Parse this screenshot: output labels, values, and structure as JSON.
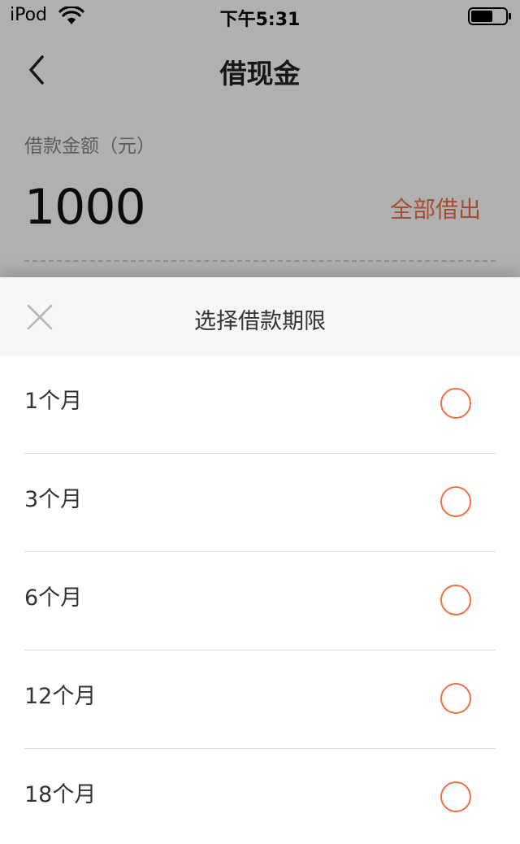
{
  "status_bar": {
    "carrier": "iPod",
    "time": "下午5:31",
    "icons": [
      "wifi-icon",
      "battery-icon"
    ]
  },
  "nav": {
    "title": "借现金",
    "back_icon": "chevron-left-icon"
  },
  "loan": {
    "amount_label": "借款金额（元）",
    "amount_value": "1000",
    "borrow_all_label": "全部借出"
  },
  "sheet": {
    "title": "选择借款期限",
    "close_icon": "close-icon",
    "terms": [
      {
        "label": "1个月",
        "selected": false
      },
      {
        "label": "3个月",
        "selected": false
      },
      {
        "label": "6个月",
        "selected": false
      },
      {
        "label": "12个月",
        "selected": false
      },
      {
        "label": "18个月",
        "selected": false
      }
    ]
  },
  "colors": {
    "accent": "#f26f45",
    "overlay": "rgba(0,0,0,0.31)",
    "sheet_header_bg": "#f5f6f8"
  }
}
